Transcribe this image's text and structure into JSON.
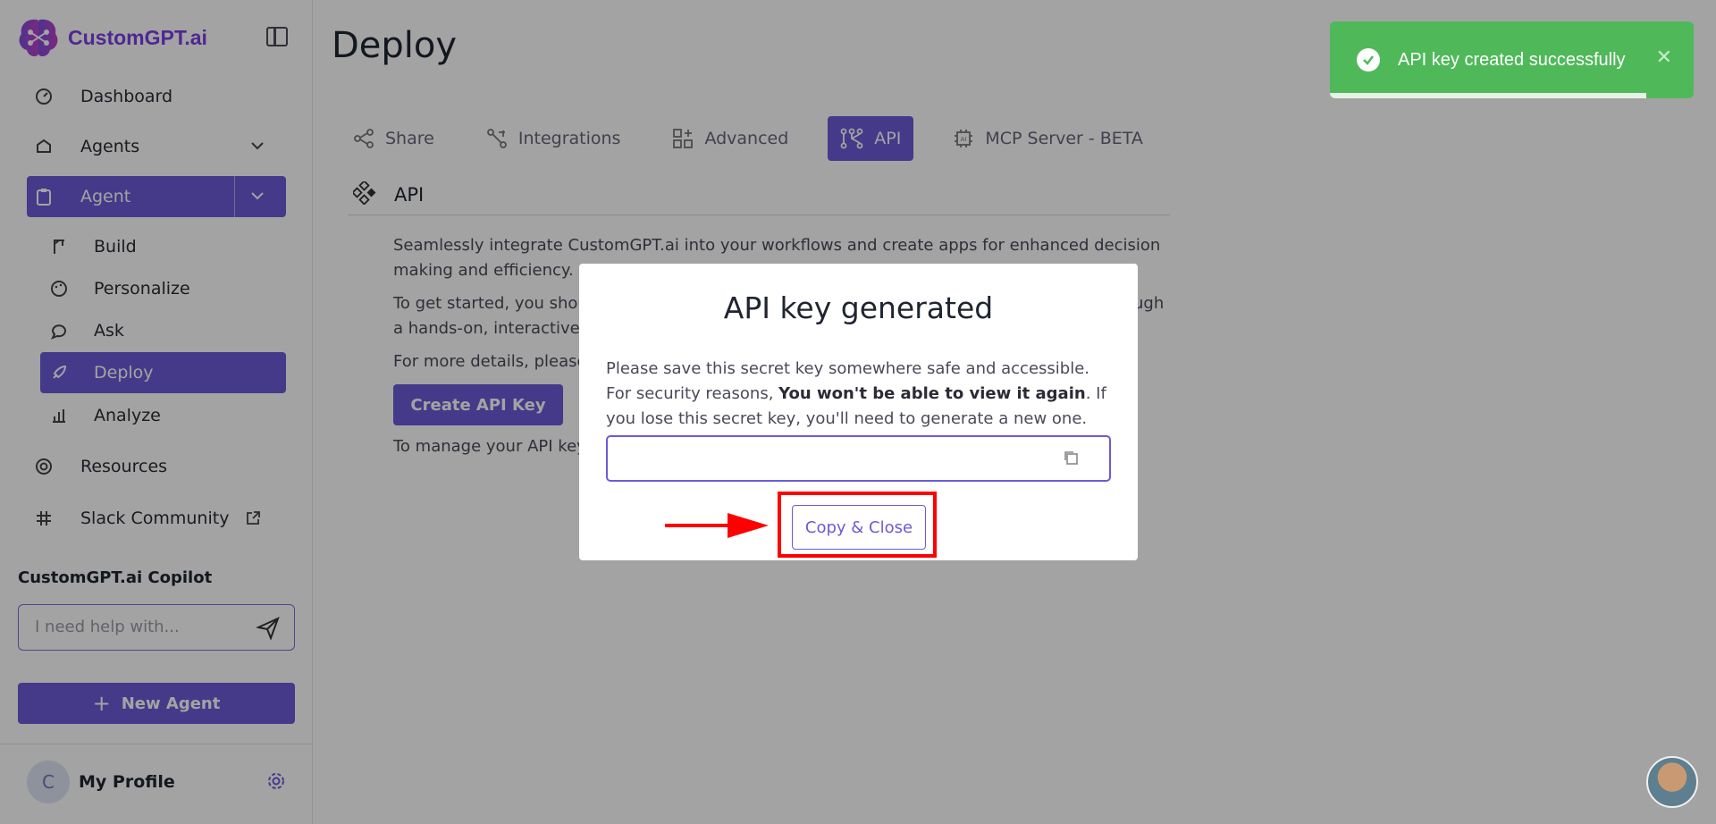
{
  "app": {
    "brand": "CustomGPT.ai"
  },
  "sidebar": {
    "items": [
      {
        "label": "Dashboard",
        "icon": "dashboard-icon"
      },
      {
        "label": "Agents",
        "icon": "agents-icon"
      },
      {
        "label": "Agent",
        "icon": "clipboard-icon"
      },
      {
        "label": "Resources",
        "icon": "lifebuoy-icon"
      },
      {
        "label": "Slack Community",
        "icon": "slack-icon"
      }
    ],
    "subitems": [
      {
        "label": "Build",
        "icon": "crane-icon"
      },
      {
        "label": "Personalize",
        "icon": "palette-icon"
      },
      {
        "label": "Ask",
        "icon": "chat-icon"
      },
      {
        "label": "Deploy",
        "icon": "rocket-icon"
      },
      {
        "label": "Analyze",
        "icon": "chart-icon"
      }
    ],
    "copilot_title": "CustomGPT.ai Copilot",
    "copilot_placeholder": "I need help with...",
    "new_agent_label": "New Agent",
    "profile_initial": "C",
    "profile_name": "My Profile"
  },
  "main": {
    "title": "Deploy",
    "tabs": [
      {
        "label": "Share",
        "icon": "share-icon"
      },
      {
        "label": "Integrations",
        "icon": "integrations-icon"
      },
      {
        "label": "Advanced",
        "icon": "advanced-icon"
      },
      {
        "label": "API",
        "icon": "api-icon"
      },
      {
        "label": "MCP Server - BETA",
        "icon": "chip-icon"
      }
    ],
    "section_title": "API",
    "para1": "Seamlessly integrate CustomGPT.ai into your workflows and create apps for enhanced decision making and efficiency.",
    "para2": "To get started, you should c",
    "para2_tail": "ugh",
    "para2_line2": "a hands-on, interactive ex",
    "para3": "For more details, please c",
    "create_btn": "Create API Key",
    "para4": "To manage your API keys"
  },
  "toast": {
    "message": "API key created successfully",
    "progress_fraction": 0.87
  },
  "modal": {
    "title": "API key generated",
    "body_pre": "Please save this secret key somewhere safe and accessible. For security reasons, ",
    "body_bold": "You won't be able to view it again",
    "body_post": ". If you lose this secret key, you'll need to generate a new one.",
    "key_value": "",
    "copy_close_label": "Copy & Close"
  },
  "colors": {
    "accent": "#6b5bd6",
    "toast": "#4fb95a",
    "highlight": "#ff0000"
  }
}
